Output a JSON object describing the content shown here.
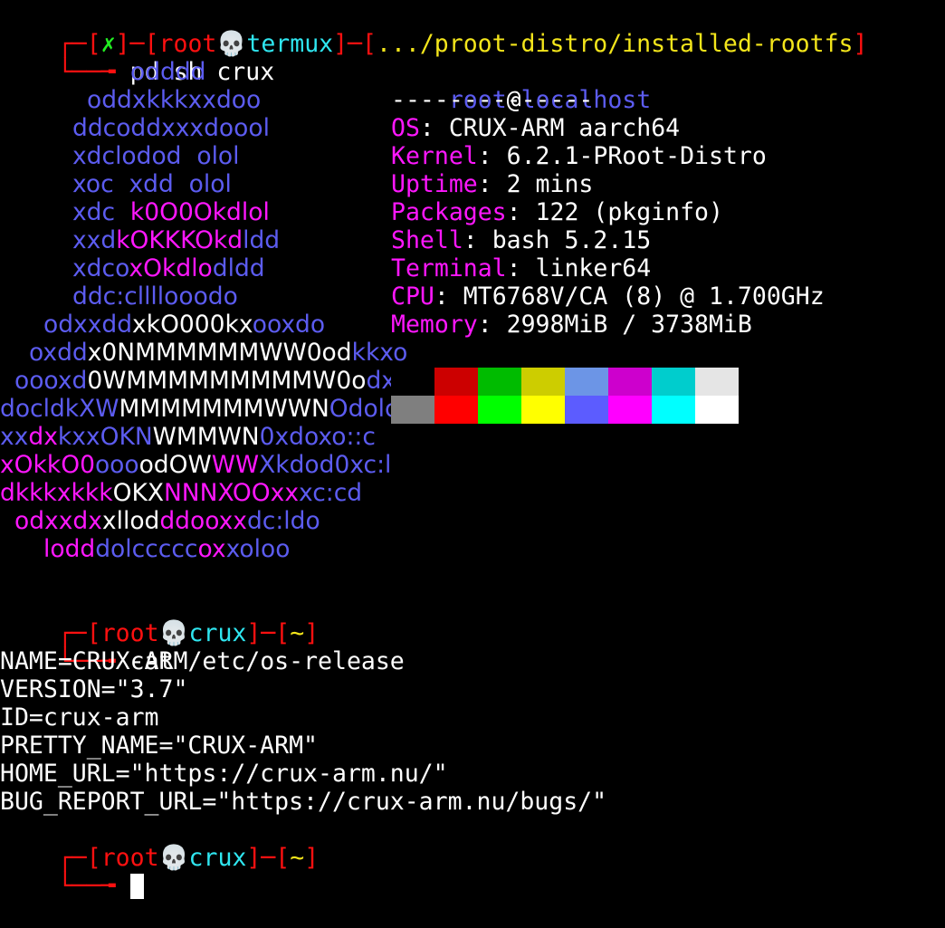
{
  "prompt1": {
    "box_tl": "┌─[",
    "status": "✗",
    "sep1": "]─[",
    "user": "root",
    "skull": "💀",
    "host": "termux",
    "sep2": "]─[",
    "cwd": ".../proot-distro/installed-rootfs",
    "close": "]",
    "arrow": "└──╼",
    "command": "pd sh crux"
  },
  "logo_lines": [
    [
      {
        "c": "blue",
        "t": "odddd"
      }
    ],
    [
      {
        "c": "blue",
        "t": "oddxkkkxxdoo"
      }
    ],
    [
      {
        "c": "blue",
        "t": "ddcoddxxxdoool"
      }
    ],
    [
      {
        "c": "blue",
        "t": "xdclodod  olol"
      }
    ],
    [
      {
        "c": "blue",
        "t": "xoc  xdd  olol"
      }
    ],
    [
      {
        "c": "blue",
        "t": "xdc  "
      },
      {
        "c": "mag",
        "t": "k0O0Okdlol"
      }
    ],
    [
      {
        "c": "blue",
        "t": "xxd"
      },
      {
        "c": "mag",
        "t": "kOKKKOkd"
      },
      {
        "c": "blue",
        "t": "ldd"
      }
    ],
    [
      {
        "c": "blue",
        "t": "xdco"
      },
      {
        "c": "mag",
        "t": "xOkdlo"
      },
      {
        "c": "blue",
        "t": "dldd"
      }
    ],
    [
      {
        "c": "blue",
        "t": "ddc:cllllooodo"
      }
    ],
    [
      {
        "c": "blue",
        "t": "odxxdd"
      },
      {
        "c": "white",
        "t": "xkO000kx"
      },
      {
        "c": "blue",
        "t": "ooxdo"
      }
    ],
    [
      {
        "c": "blue",
        "t": "oxdd"
      },
      {
        "c": "white",
        "t": "x0NMMMMMMWW0od"
      },
      {
        "c": "blue",
        "t": "kkxo"
      }
    ],
    [
      {
        "c": "blue",
        "t": "oooxd"
      },
      {
        "c": "white",
        "t": "0WMMMMMMMMMW0o"
      },
      {
        "c": "blue",
        "t": "dxkx"
      }
    ],
    [
      {
        "c": "blue",
        "t": "docldkXW"
      },
      {
        "c": "white",
        "t": "MMMMMMMWWN"
      },
      {
        "c": "blue",
        "t": "Odolco"
      }
    ],
    [
      {
        "c": "blue",
        "t": "xx"
      },
      {
        "c": "mag",
        "t": "dx"
      },
      {
        "c": "blue",
        "t": "kxxOKN"
      },
      {
        "c": "white",
        "t": "WMMWN"
      },
      {
        "c": "blue",
        "t": "0xdoxo::c"
      }
    ],
    [
      {
        "c": "mag",
        "t": "xOkkO0"
      },
      {
        "c": "blue",
        "t": "ooo"
      },
      {
        "c": "white",
        "t": "odOW"
      },
      {
        "c": "mag",
        "t": "WW"
      },
      {
        "c": "blue",
        "t": "Xkdod0xc:l"
      }
    ],
    [
      {
        "c": "mag",
        "t": "dkkkxkkk"
      },
      {
        "c": "white",
        "t": "OKX"
      },
      {
        "c": "mag",
        "t": "NNNXOOxx"
      },
      {
        "c": "blue",
        "t": "xc:cd"
      }
    ],
    [
      {
        "c": "mag",
        "t": "odxxdx"
      },
      {
        "c": "white",
        "t": "xllod"
      },
      {
        "c": "mag",
        "t": "ddooxx"
      },
      {
        "c": "blue",
        "t": "dc:ldo"
      }
    ],
    [
      {
        "c": "mag",
        "t": "lodd"
      },
      {
        "c": "blue",
        "t": "dolccccc"
      },
      {
        "c": "mag",
        "t": "ox"
      },
      {
        "c": "blue",
        "t": "xoloo"
      }
    ]
  ],
  "info": {
    "user": "root",
    "at": "@",
    "host": "localhost",
    "divider": "--------------",
    "rows": [
      {
        "key": "OS",
        "value": ": CRUX-ARM aarch64"
      },
      {
        "key": "Kernel",
        "value": ": 6.2.1-PRoot-Distro"
      },
      {
        "key": "Uptime",
        "value": ": 2 mins"
      },
      {
        "key": "Packages",
        "value": ": 122 (pkginfo)"
      },
      {
        "key": "Shell",
        "value": ": bash 5.2.15"
      },
      {
        "key": "Terminal",
        "value": ": linker64"
      },
      {
        "key": "CPU",
        "value": ": MT6768V/CA (8) @ 1.700GHz"
      },
      {
        "key": "Memory",
        "value": ": 2998MiB / 3738MiB"
      }
    ],
    "palette_top": [
      "#000000",
      "#cc0000",
      "#00bb00",
      "#cdcd00",
      "#6c95e6",
      "#cd00cd",
      "#00cdcd",
      "#e5e5e5"
    ],
    "palette_bottom": [
      "#7f7f7f",
      "#ff0000",
      "#00ff00",
      "#ffff00",
      "#5c5cff",
      "#ff00ff",
      "#00ffff",
      "#ffffff"
    ]
  },
  "prompt2": {
    "box_tl": "┌─[",
    "user": "root",
    "skull": "💀",
    "host": "crux",
    "sep": "]─[",
    "cwd": "~",
    "close": "]",
    "arrow": "└──╼",
    "command": "cat /etc/os-release"
  },
  "os_release": [
    "NAME=CRUX-ARM",
    "VERSION=\"3.7\"",
    "ID=crux-arm",
    "PRETTY_NAME=\"CRUX-ARM\"",
    "HOME_URL=\"https://crux-arm.nu/\"",
    "BUG_REPORT_URL=\"https://crux-arm.nu/bugs/\""
  ],
  "prompt3": {
    "box_tl": "┌─[",
    "user": "root",
    "skull": "💀",
    "host": "crux",
    "sep": "]─[",
    "cwd": "~",
    "close": "]",
    "arrow": "└──╼",
    "command": ""
  }
}
